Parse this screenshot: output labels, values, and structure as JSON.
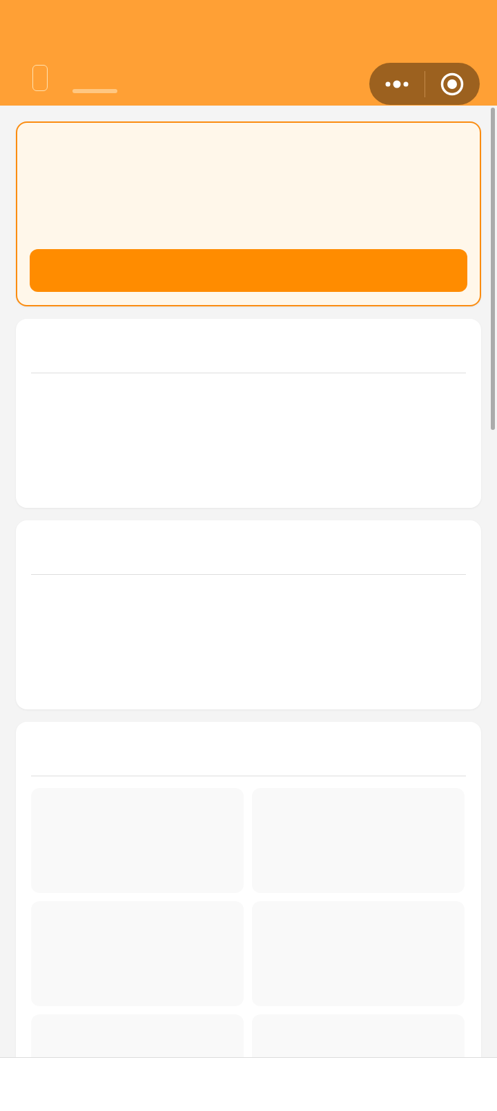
{
  "cards": [
    {
      "kind": "highlight"
    },
    {
      "kind": "list"
    },
    {
      "kind": "list"
    },
    {
      "kind": "grid",
      "tiles": [
        {
          "kind": "placeholder"
        },
        {
          "kind": "placeholder"
        },
        {
          "kind": "placeholder"
        },
        {
          "kind": "placeholder"
        },
        {
          "kind": "placeholder"
        },
        {
          "kind": "placeholder"
        }
      ]
    }
  ]
}
